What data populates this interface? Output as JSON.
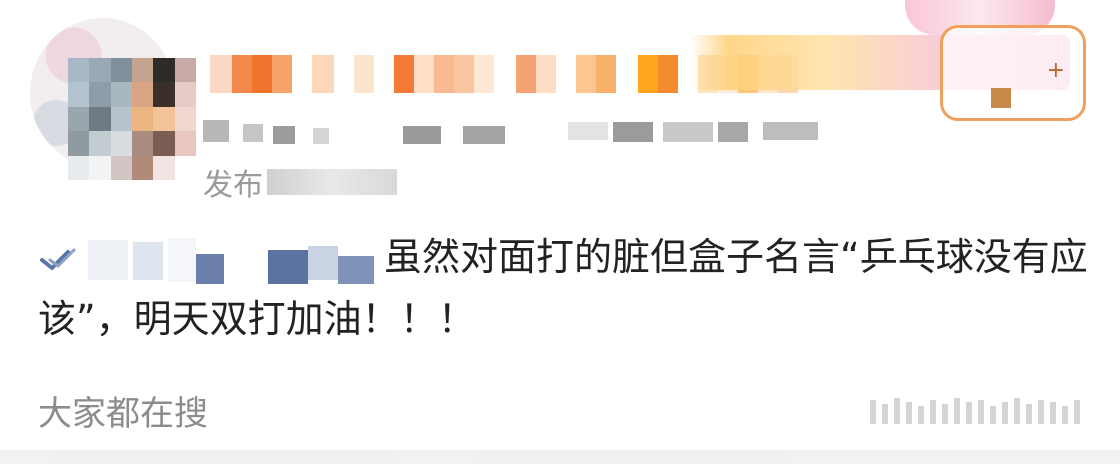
{
  "post": {
    "source_prefix": "发布",
    "text": "虽然对面打的脏但盒子名言“乒乓球没有应该”，明天双打加油！！！"
  },
  "footer": {
    "section_title": "大家都在搜"
  },
  "colors": {
    "text": "#222222",
    "muted": "#8c8c8c",
    "link_blue": "#5874a8",
    "badge_orange": "#f0a05c",
    "badge_pink": "#f4a7c6"
  },
  "icons": {
    "mention_icon": "link-arrow-icon",
    "badge_icon": "fan-badge-icon"
  }
}
